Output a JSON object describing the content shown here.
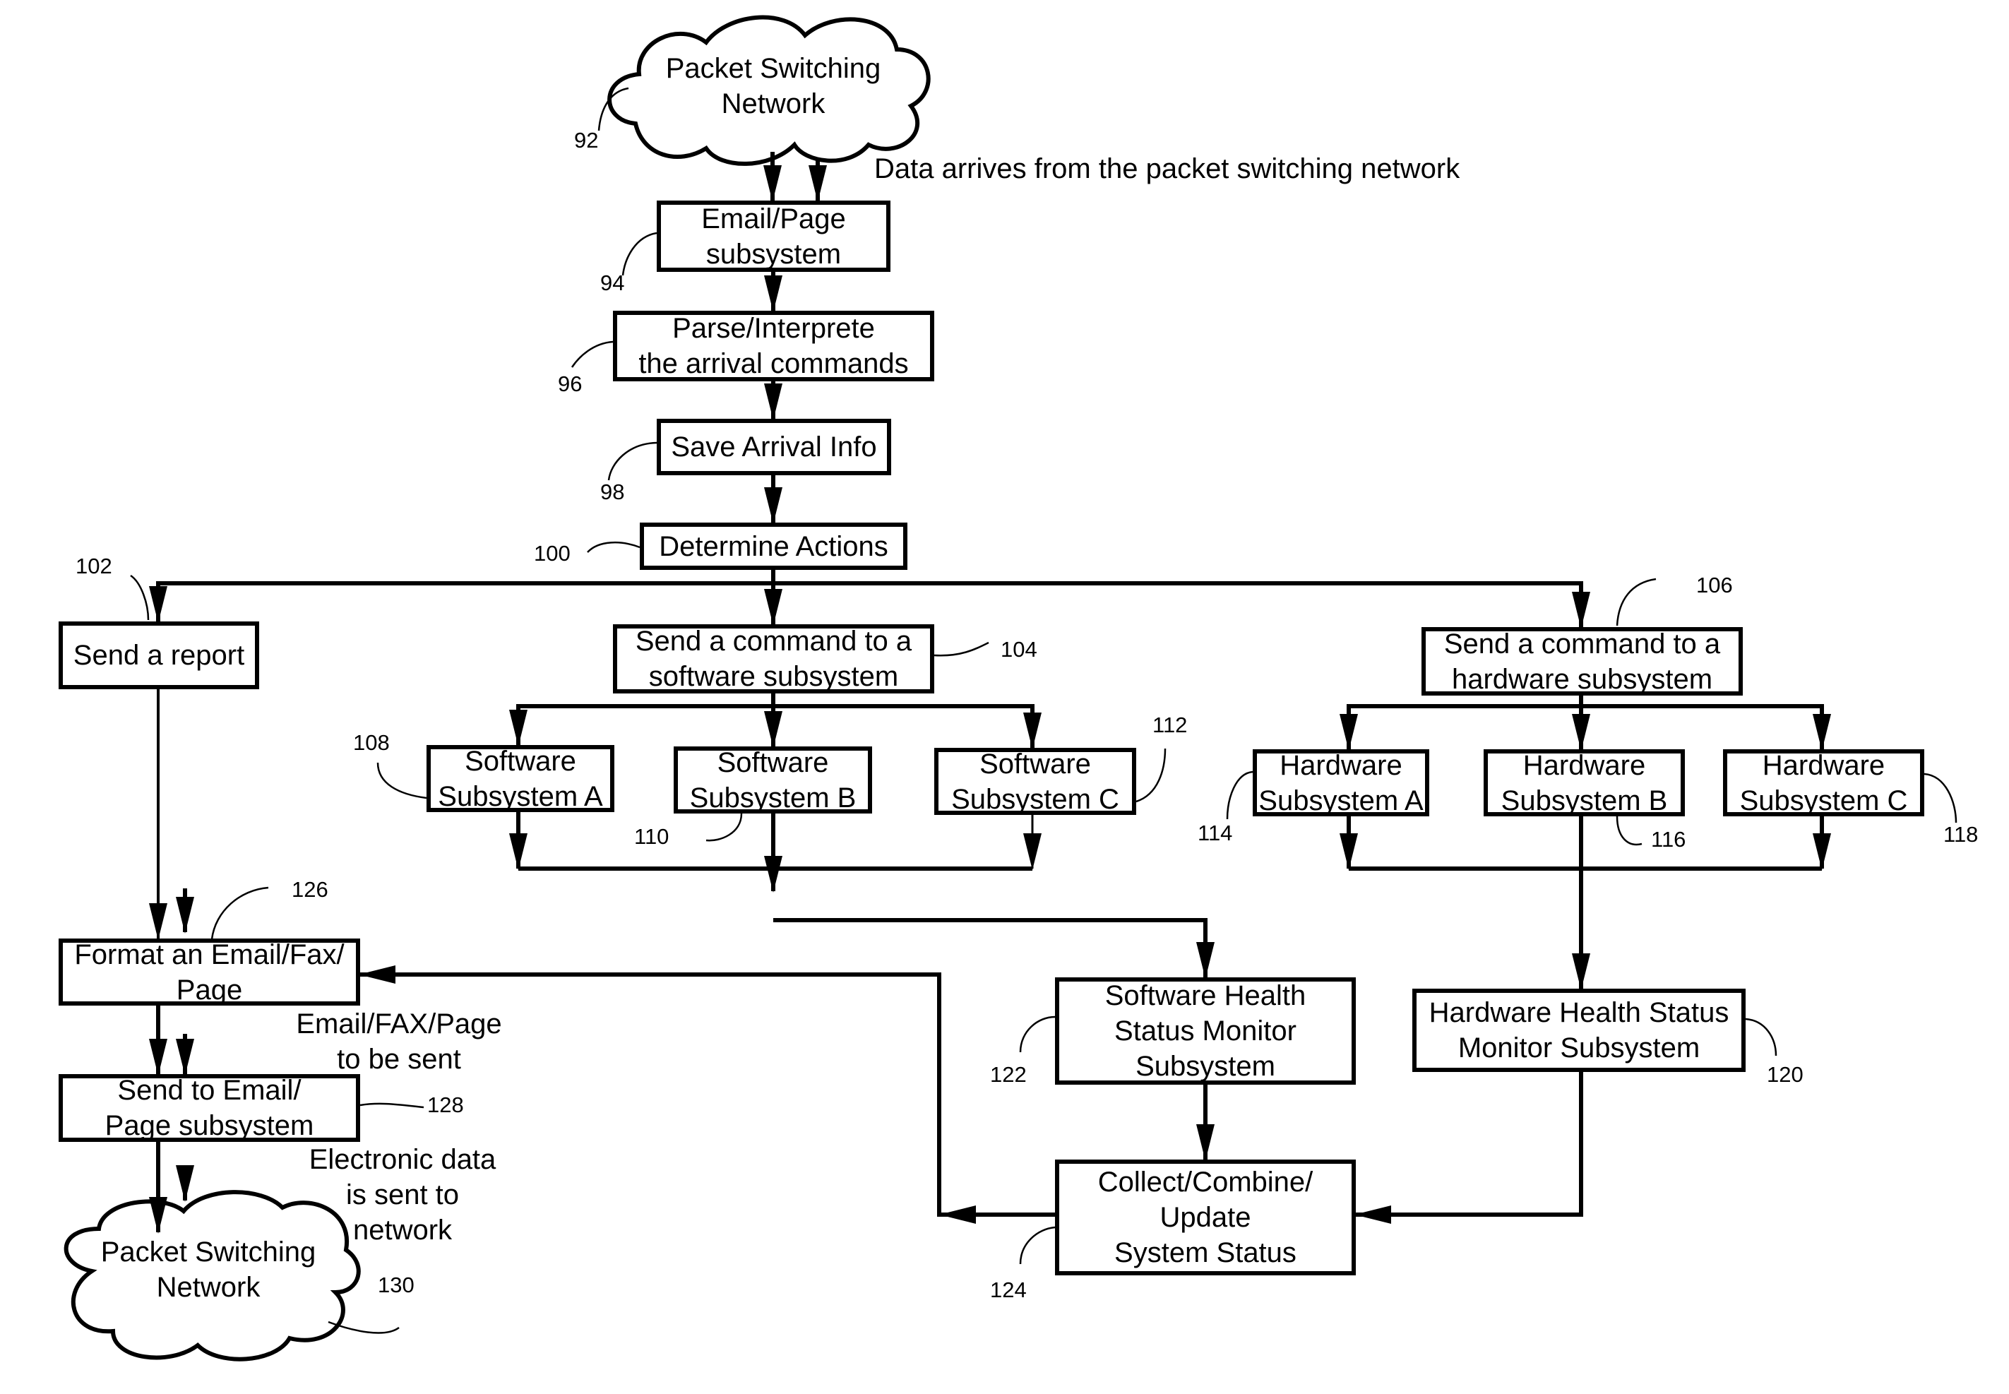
{
  "diagram": {
    "nodes": {
      "n92": {
        "label": "Packet Switching\nNetwork",
        "ref": "92",
        "shape": "cloud"
      },
      "n94": {
        "label": "Email/Page\nsubsystem",
        "ref": "94"
      },
      "n96": {
        "label": "Parse/Interprete\nthe arrival commands",
        "ref": "96"
      },
      "n98": {
        "label": "Save Arrival Info",
        "ref": "98"
      },
      "n100": {
        "label": "Determine Actions",
        "ref": "100"
      },
      "n102": {
        "label": "Send a report",
        "ref": "102"
      },
      "n104": {
        "label": "Send a command to a\nsoftware subsystem",
        "ref": "104"
      },
      "n106": {
        "label": "Send a command to a\nhardware subsystem",
        "ref": "106"
      },
      "n108": {
        "label": "Software\nSubsystem A",
        "ref": "108"
      },
      "n110": {
        "label": "Software\nSubsystem B",
        "ref": "110"
      },
      "n112": {
        "label": "Software\nSubsystem C",
        "ref": "112"
      },
      "n114": {
        "label": "Hardware\nSubsystem A",
        "ref": "114"
      },
      "n116": {
        "label": "Hardware\nSubsystem B",
        "ref": "116"
      },
      "n118": {
        "label": "Hardware\nSubsystem C",
        "ref": "118"
      },
      "n120": {
        "label": "Hardware Health Status\nMonitor Subsystem",
        "ref": "120"
      },
      "n122": {
        "label": "Software Health\nStatus Monitor\nSubsystem",
        "ref": "122"
      },
      "n124": {
        "label": "Collect/Combine/\nUpdate\nSystem Status",
        "ref": "124"
      },
      "n126": {
        "label": "Format an Email/Fax/\nPage",
        "ref": "126"
      },
      "n128": {
        "label": "Send to Email/\nPage subsystem",
        "ref": "128"
      },
      "n130": {
        "label": "Packet Switching\nNetwork",
        "ref": "130",
        "shape": "cloud"
      }
    },
    "annotations": {
      "data_arrives": "Data arrives from the packet switching network",
      "to_be_sent": "Email/FAX/Page\nto be sent",
      "electronic_data": "Electronic data\nis sent to\nnetwork"
    },
    "edges": [
      [
        "n92",
        "n94"
      ],
      [
        "n94",
        "n96"
      ],
      [
        "n96",
        "n98"
      ],
      [
        "n98",
        "n100"
      ],
      [
        "n100",
        "n102"
      ],
      [
        "n100",
        "n104"
      ],
      [
        "n100",
        "n106"
      ],
      [
        "n104",
        "n108"
      ],
      [
        "n104",
        "n110"
      ],
      [
        "n104",
        "n112"
      ],
      [
        "n106",
        "n114"
      ],
      [
        "n106",
        "n116"
      ],
      [
        "n106",
        "n118"
      ],
      [
        "n108",
        "sw-join"
      ],
      [
        "n112",
        "sw-join"
      ],
      [
        "sw-join",
        "n122"
      ],
      [
        "n110",
        "n122"
      ],
      [
        "n114",
        "hw-join"
      ],
      [
        "n118",
        "hw-join"
      ],
      [
        "n116",
        "n120"
      ],
      [
        "n122",
        "n124"
      ],
      [
        "n120",
        "n124"
      ],
      [
        "n124",
        "n126"
      ],
      [
        "n102",
        "n126"
      ],
      [
        "n126",
        "n128"
      ],
      [
        "n128",
        "n130"
      ]
    ]
  }
}
